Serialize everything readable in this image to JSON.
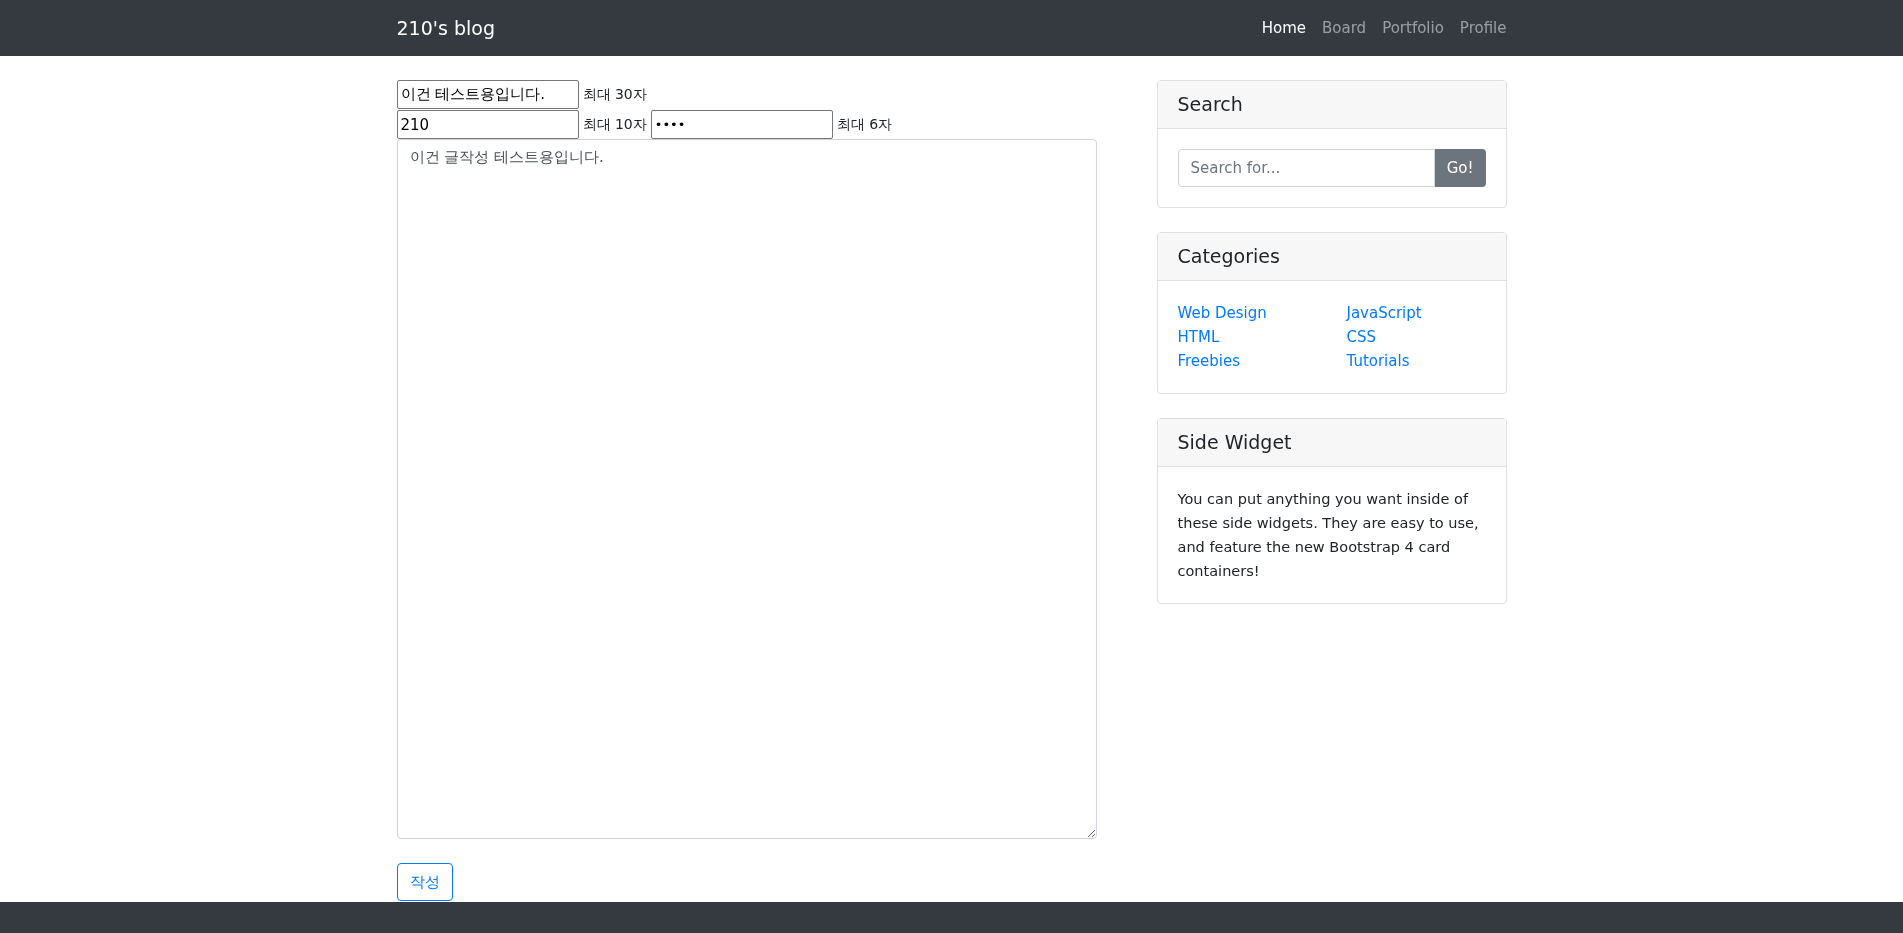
{
  "navbar": {
    "brand": "210's blog",
    "links": [
      {
        "label": "Home",
        "selected": true
      },
      {
        "label": "Board",
        "selected": false
      },
      {
        "label": "Portfolio",
        "selected": false
      },
      {
        "label": "Profile",
        "selected": false
      }
    ]
  },
  "form": {
    "title": {
      "value": "이건 테스트용입니다.",
      "hint": "최대 30자"
    },
    "author": {
      "value": "210",
      "hint": "최대 10자"
    },
    "password": {
      "value": "••••",
      "hint": "최대 6자"
    },
    "content": {
      "value": "이건 글작성 테스트용입니다."
    },
    "submit": "작성"
  },
  "sidebar": {
    "search": {
      "title": "Search",
      "placeholder": "Search for...",
      "button": "Go!"
    },
    "categories": {
      "title": "Categories",
      "columns": [
        [
          "Web Design",
          "HTML",
          "Freebies"
        ],
        [
          "JavaScript",
          "CSS",
          "Tutorials"
        ]
      ]
    },
    "widget": {
      "title": "Side Widget",
      "text": "You can put anything you want inside of these side widgets. They are easy to use, and feature the new Bootstrap 4 card containers!"
    }
  }
}
